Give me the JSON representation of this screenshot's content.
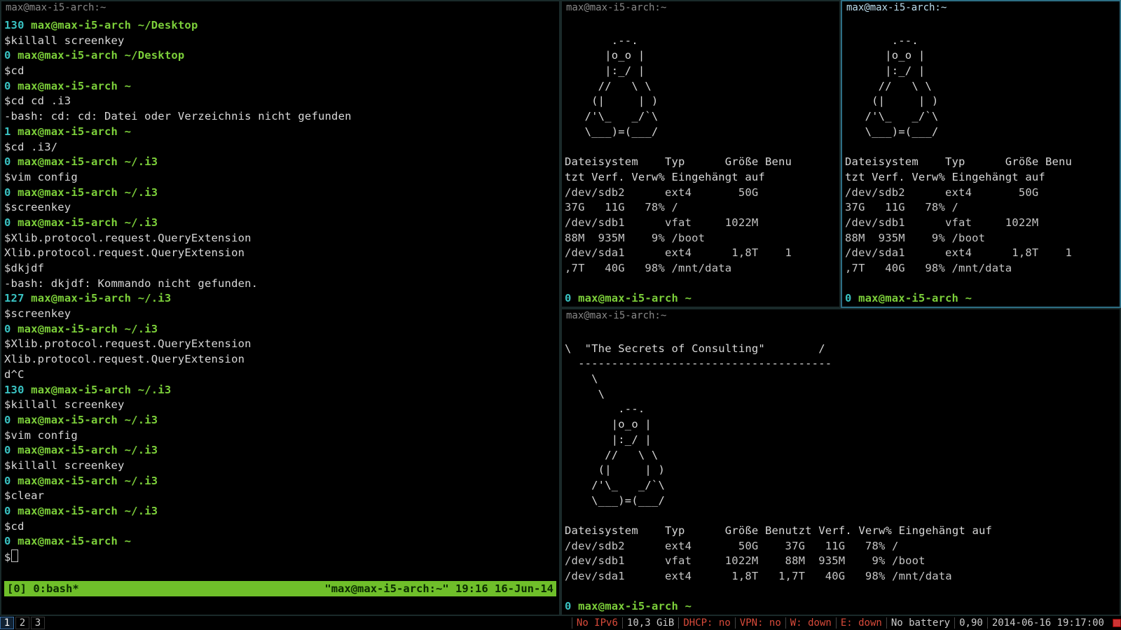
{
  "window_title": "max@max-i5-arch:~",
  "panes": {
    "left": {
      "title": "max@max-i5-arch:~",
      "lines": [
        {
          "t": "prompt",
          "code": "130",
          "user": "max@max-i5-arch",
          "path": "~/Desktop"
        },
        {
          "t": "cmd",
          "text": "$killall screenkey"
        },
        {
          "t": "prompt",
          "code": "0",
          "user": "max@max-i5-arch",
          "path": "~/Desktop"
        },
        {
          "t": "cmd",
          "text": "$cd"
        },
        {
          "t": "prompt",
          "code": "0",
          "user": "max@max-i5-arch",
          "path": "~"
        },
        {
          "t": "cmd",
          "text": "$cd cd .i3"
        },
        {
          "t": "out",
          "text": "-bash: cd: cd: Datei oder Verzeichnis nicht gefunden"
        },
        {
          "t": "prompt",
          "code": "1",
          "user": "max@max-i5-arch",
          "path": "~"
        },
        {
          "t": "cmd",
          "text": "$cd .i3/"
        },
        {
          "t": "prompt",
          "code": "0",
          "user": "max@max-i5-arch",
          "path": "~/.i3"
        },
        {
          "t": "cmd",
          "text": "$vim config"
        },
        {
          "t": "prompt",
          "code": "0",
          "user": "max@max-i5-arch",
          "path": "~/.i3"
        },
        {
          "t": "cmd",
          "text": "$screenkey"
        },
        {
          "t": "prompt",
          "code": "0",
          "user": "max@max-i5-arch",
          "path": "~/.i3"
        },
        {
          "t": "cmd",
          "text": "$Xlib.protocol.request.QueryExtension"
        },
        {
          "t": "out",
          "text": "Xlib.protocol.request.QueryExtension"
        },
        {
          "t": "cmd",
          "text": "$dkjdf"
        },
        {
          "t": "out",
          "text": "-bash: dkjdf: Kommando nicht gefunden."
        },
        {
          "t": "prompt",
          "code": "127",
          "user": "max@max-i5-arch",
          "path": "~/.i3"
        },
        {
          "t": "cmd",
          "text": "$screenkey"
        },
        {
          "t": "prompt",
          "code": "0",
          "user": "max@max-i5-arch",
          "path": "~/.i3"
        },
        {
          "t": "cmd",
          "text": "$Xlib.protocol.request.QueryExtension"
        },
        {
          "t": "out",
          "text": "Xlib.protocol.request.QueryExtension"
        },
        {
          "t": "out",
          "text": "d^C"
        },
        {
          "t": "prompt",
          "code": "130",
          "user": "max@max-i5-arch",
          "path": "~/.i3"
        },
        {
          "t": "cmd",
          "text": "$killall screenkey"
        },
        {
          "t": "prompt",
          "code": "0",
          "user": "max@max-i5-arch",
          "path": "~/.i3"
        },
        {
          "t": "cmd",
          "text": "$vim config"
        },
        {
          "t": "prompt",
          "code": "0",
          "user": "max@max-i5-arch",
          "path": "~/.i3"
        },
        {
          "t": "cmd",
          "text": "$killall screenkey"
        },
        {
          "t": "prompt",
          "code": "0",
          "user": "max@max-i5-arch",
          "path": "~/.i3"
        },
        {
          "t": "cmd",
          "text": "$clear"
        },
        {
          "t": "prompt",
          "code": "0",
          "user": "max@max-i5-arch",
          "path": "~/.i3"
        },
        {
          "t": "cmd",
          "text": "$cd"
        },
        {
          "t": "prompt",
          "code": "0",
          "user": "max@max-i5-arch",
          "path": "~"
        },
        {
          "t": "cursor",
          "text": "$"
        }
      ],
      "tmux": {
        "left": "[0] 0:bash*",
        "right": "\"max@max-i5-arch:~\" 19:16 16-Jun-14"
      }
    },
    "top_right": {
      "title": "max@max-i5-arch:~",
      "ascii": "       .--.\n      |o_o |\n      |:_/ |\n     //   \\ \\\n    (|     | )\n   /'\\_   _/`\\\n   \\___)=(___/",
      "df_header": "Dateisystem    Typ      Größe Benu\ntzt Verf. Verw% Eingehängt auf",
      "df_rows": [
        "/dev/sdb2      ext4       50G   \n37G   11G   78% /",
        "/dev/sdb1      vfat     1022M   \n88M  935M    9% /boot",
        "/dev/sda1      ext4      1,8T    1\n,7T   40G   98% /mnt/data"
      ],
      "prompt": {
        "code": "0",
        "user": "max@max-i5-arch",
        "path": "~"
      },
      "prompt_char": "$"
    },
    "top_right_right": {
      "title": "max@max-i5-arch:~",
      "ascii": "       .--.\n      |o_o |\n      |:_/ |\n     //   \\ \\\n    (|     | )\n   /'\\_   _/`\\\n   \\___)=(___/",
      "df_header": "Dateisystem    Typ      Größe Benu\ntzt Verf. Verw% Eingehängt auf",
      "df_rows": [
        "/dev/sdb2      ext4       50G   \n37G   11G   78% /",
        "/dev/sdb1      vfat     1022M   \n88M  935M    9% /boot",
        "/dev/sda1      ext4      1,8T    1\n,7T   40G   98% /mnt/data"
      ],
      "prompt": {
        "code": "0",
        "user": "max@max-i5-arch",
        "path": "~"
      },
      "prompt_char": "$"
    },
    "bottom_right": {
      "title": "max@max-i5-arch:~",
      "quote_line": "\\  \"The Secrets of Consulting\"        /",
      "quote_rule": "  -------------------------------------- ",
      "quote_tail1": "    \\",
      "quote_tail2": "     \\",
      "ascii": "        .--.\n       |o_o |\n       |:_/ |\n      //   \\ \\\n     (|     | )\n    /'\\_   _/`\\\n    \\___)=(___/",
      "df_header": "Dateisystem    Typ      Größe Benutzt Verf. Verw% Eingehängt auf",
      "df_rows": [
        "/dev/sdb2      ext4       50G    37G   11G   78% /",
        "/dev/sdb1      vfat     1022M    88M  935M    9% /boot",
        "/dev/sda1      ext4      1,8T   1,7T   40G   98% /mnt/data"
      ],
      "prompt": {
        "code": "0",
        "user": "max@max-i5-arch",
        "path": "~"
      },
      "prompt_char": "$"
    }
  },
  "i3bar": {
    "workspaces": [
      "1",
      "2",
      "3"
    ],
    "active_ws": "1",
    "status": {
      "ipv6": "No IPv6",
      "mem": "10,3 GiB",
      "dhcp": "DHCP: no",
      "vpn": "VPN: no",
      "wdown": "W: down",
      "edown": "E: down",
      "battery": "No battery",
      "load": "0,90",
      "datetime": "2014-06-16 19:17:00"
    }
  }
}
